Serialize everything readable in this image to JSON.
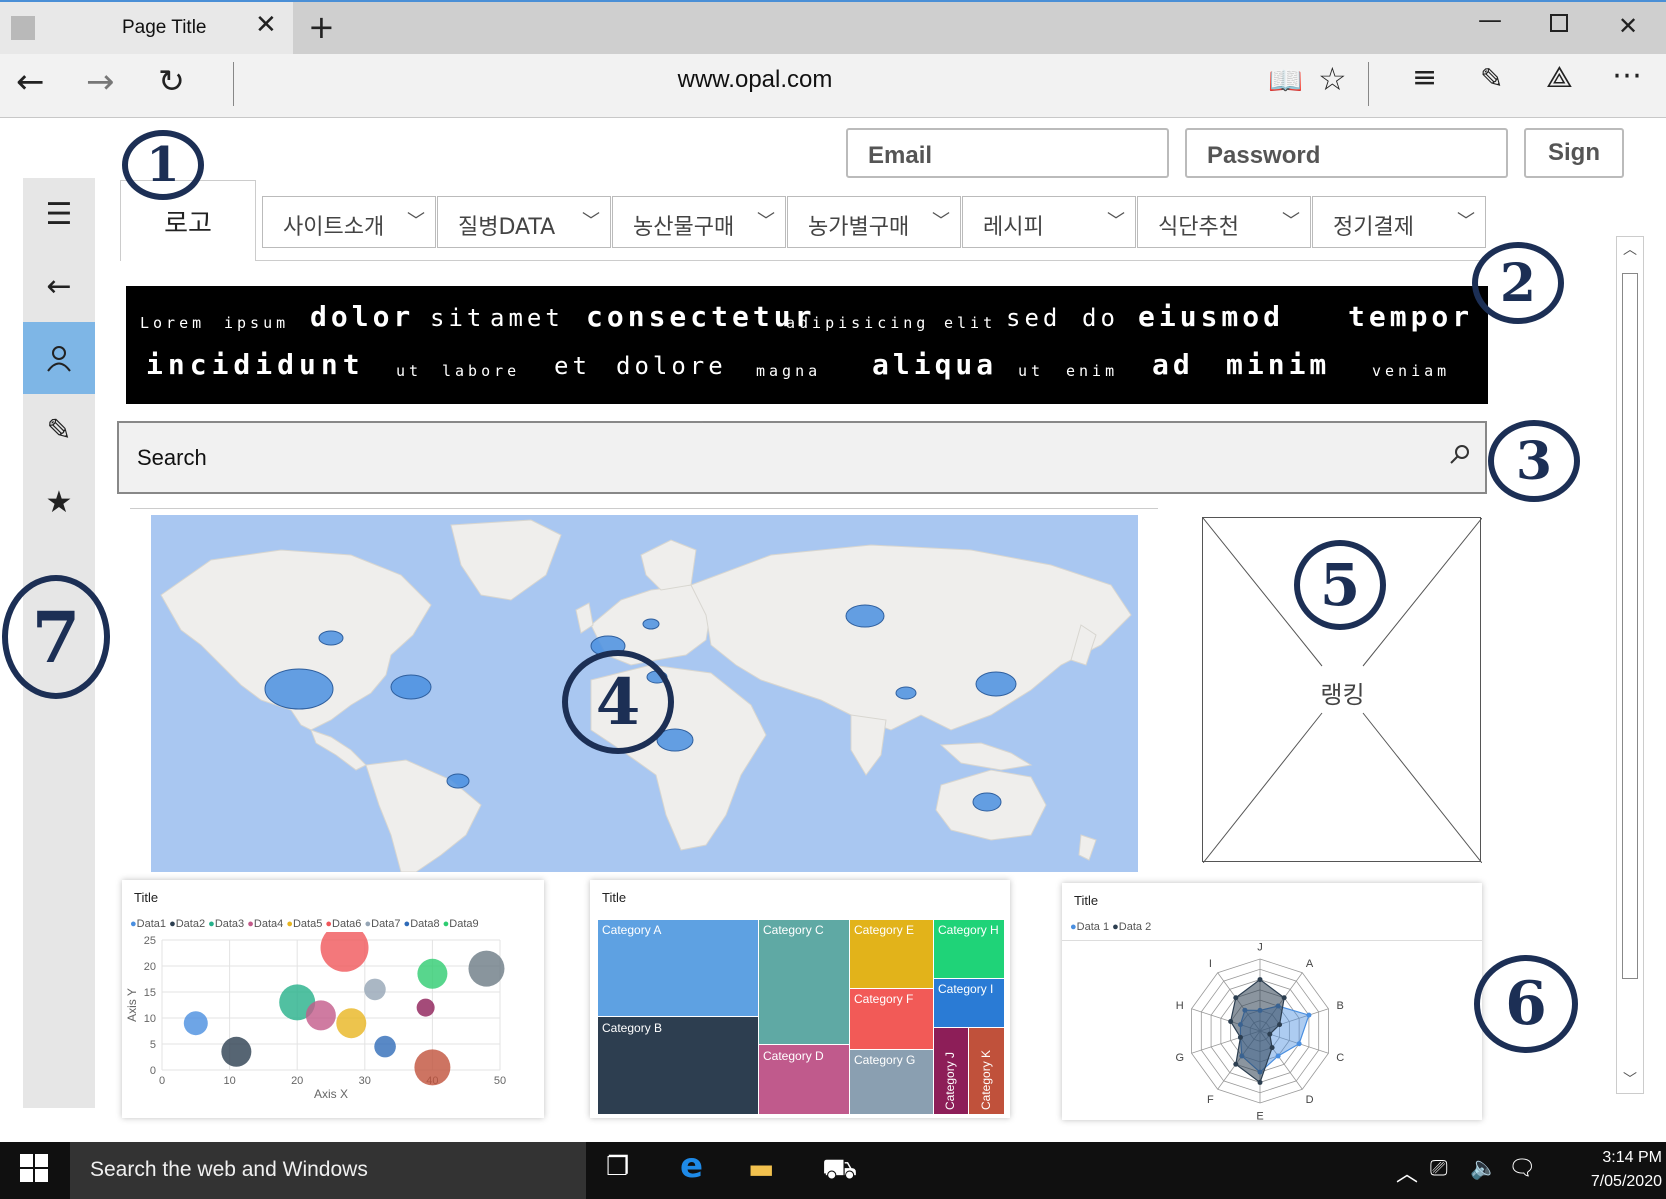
{
  "browser": {
    "tab_title": "Page Title",
    "url": "www.opal.com"
  },
  "login": {
    "email_placeholder": "Email",
    "password_placeholder": "Password",
    "sign_label": "Sign"
  },
  "logo": "로고",
  "menu": [
    {
      "label": "사이트소개"
    },
    {
      "label": "질병DATA"
    },
    {
      "label": "농산물구매"
    },
    {
      "label": "농가별구매"
    },
    {
      "label": "레시피"
    },
    {
      "label": "식단추천"
    },
    {
      "label": "정기결제"
    }
  ],
  "word_cloud": [
    "Lorem",
    "ipsum",
    "dolor",
    "sit",
    "amet",
    "consectetur",
    "adipisicing",
    "elit",
    "sed",
    "do",
    "eiusmod",
    "tempor",
    "incididunt",
    "ut",
    "labore",
    "et",
    "dolore",
    "magna",
    "aliqua",
    "ut",
    "enim",
    "ad",
    "minim",
    "veniam"
  ],
  "search": {
    "placeholder": "Search"
  },
  "ranking": {
    "label": "랭킹"
  },
  "annotations": [
    "1",
    "2",
    "3",
    "4",
    "5",
    "6",
    "7"
  ],
  "bubble_chart": {
    "title": "Title",
    "legend": [
      "Data1",
      "Data2",
      "Data3",
      "Data4",
      "Data5",
      "Data6",
      "Data7",
      "Data8",
      "Data9"
    ],
    "chart_data": {
      "type": "scatter",
      "xlabel": "Axis X",
      "ylabel": "Axis Y",
      "xlim": [
        0,
        50
      ],
      "ylim": [
        0,
        25
      ],
      "x_ticks": [
        0,
        10,
        20,
        30,
        40,
        50
      ],
      "y_ticks": [
        0,
        5,
        10,
        15,
        20,
        25
      ],
      "series": [
        {
          "name": "Data1",
          "points": [
            {
              "x": 5,
              "y": 9,
              "r": 2
            }
          ]
        },
        {
          "name": "Data2",
          "points": [
            {
              "x": 11,
              "y": 3.5,
              "r": 2.5
            }
          ]
        },
        {
          "name": "Data3",
          "points": [
            {
              "x": 20,
              "y": 13,
              "r": 3
            },
            {
              "x": 40,
              "y": 18.5,
              "r": 2.5
            }
          ]
        },
        {
          "name": "Data4",
          "points": [
            {
              "x": 23.5,
              "y": 10.5,
              "r": 2.5
            },
            {
              "x": 39,
              "y": 12,
              "r": 1.5
            }
          ]
        },
        {
          "name": "Data5",
          "points": [
            {
              "x": 28,
              "y": 9,
              "r": 2.5
            }
          ]
        },
        {
          "name": "Data6",
          "points": [
            {
              "x": 27,
              "y": 23.5,
              "r": 4
            }
          ]
        },
        {
          "name": "Data7",
          "points": [
            {
              "x": 31.5,
              "y": 15.5,
              "r": 1.8
            }
          ]
        },
        {
          "name": "Data8",
          "points": [
            {
              "x": 33,
              "y": 4.5,
              "r": 1.8
            }
          ]
        },
        {
          "name": "Data9",
          "points": [
            {
              "x": 48,
              "y": 19.5,
              "r": 3
            },
            {
              "x": 40,
              "y": 0.5,
              "r": 3
            }
          ]
        }
      ]
    }
  },
  "treemap_chart": {
    "title": "Title",
    "chart_data": {
      "type": "treemap",
      "categories": [
        "Category A",
        "Category B",
        "Category C",
        "Category D",
        "Category E",
        "Category F",
        "Category G",
        "Category H",
        "Category I",
        "Category J",
        "Category K"
      ]
    }
  },
  "radar_chart": {
    "title": "Title",
    "legend": [
      "Data 1",
      "Data 2"
    ],
    "chart_data": {
      "type": "radar",
      "axes": [
        "J",
        "A",
        "B",
        "C",
        "D",
        "E",
        "F",
        "G",
        "H",
        "I"
      ],
      "rings": [
        10,
        20,
        30,
        40,
        50,
        60,
        70
      ],
      "series": [
        {
          "name": "Data 1",
          "values": [
            20,
            30,
            50,
            40,
            30,
            40,
            30,
            20,
            20,
            25
          ]
        },
        {
          "name": "Data 2",
          "values": [
            50,
            40,
            20,
            10,
            20,
            50,
            40,
            20,
            30,
            40
          ]
        }
      ]
    }
  },
  "taskbar": {
    "search_text": "Search the web and Windows",
    "time": "3:14 PM",
    "date": "7/05/2020"
  },
  "colors": {
    "accent": "#7eb6e6",
    "annotation_ink": "#1c2f55",
    "map_water": "#a9c7f1",
    "map_land": "#efeeec",
    "bubble_blue": "#4a8fe0"
  }
}
